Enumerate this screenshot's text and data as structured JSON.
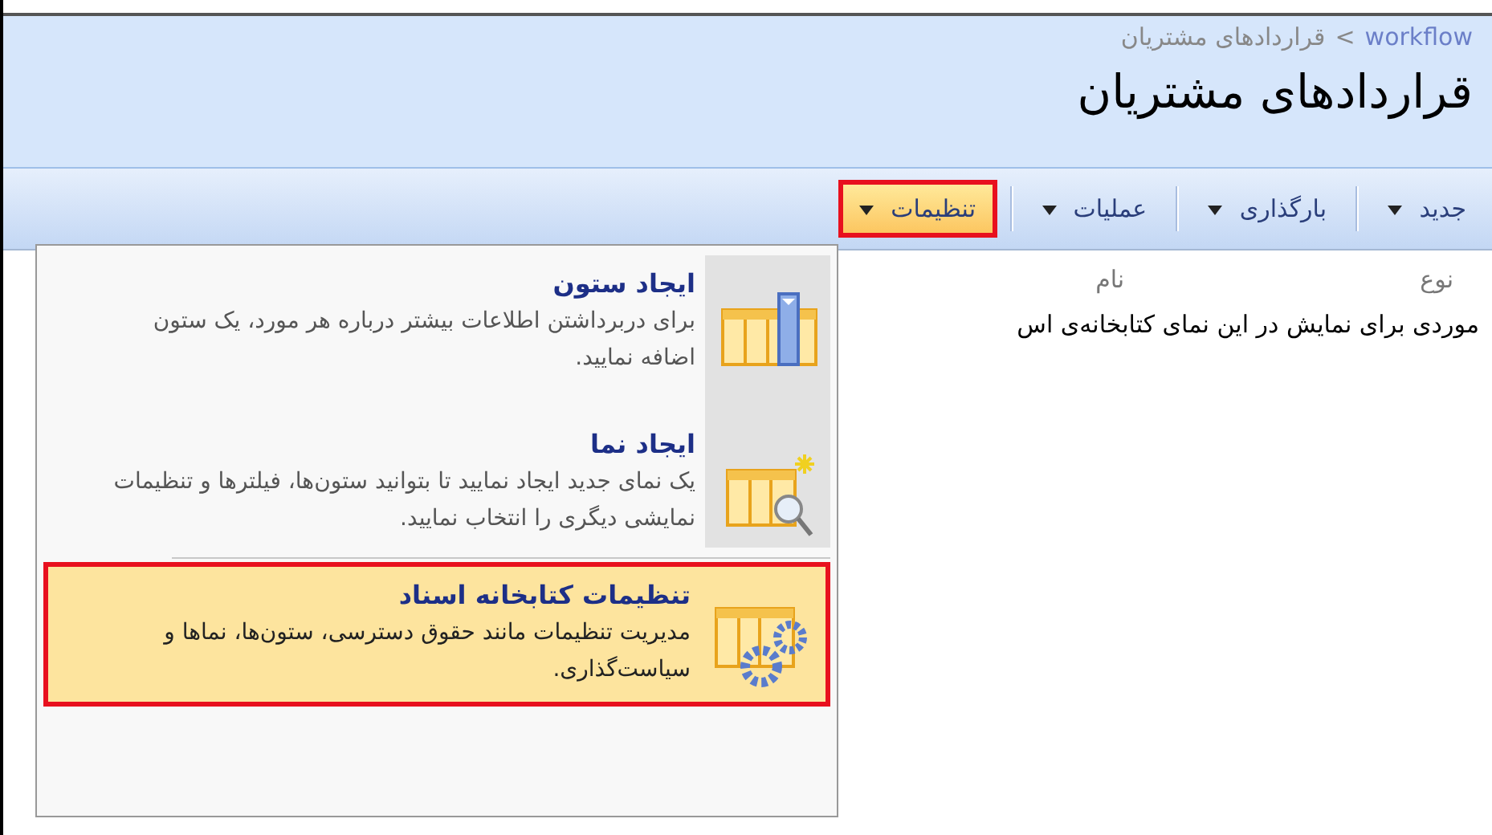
{
  "breadcrumb": {
    "root": "workflow",
    "separator": ">",
    "current": "قراردادهای مشتریان"
  },
  "page_title": "قراردادهای مشتریان",
  "toolbar": [
    {
      "label": "جدید",
      "selected": false
    },
    {
      "label": "بارگذاری",
      "selected": false
    },
    {
      "label": "عملیات",
      "selected": false
    },
    {
      "label": "تنظیمات",
      "selected": true
    }
  ],
  "table": {
    "columns": [
      "نوع",
      "نام"
    ],
    "empty_message": "موردی برای نمایش در این نمای کتابخانه‌ی اس"
  },
  "menu": [
    {
      "kind": "column",
      "title": "ایجاد ستون",
      "description": "برای دربرداشتن اطلاعات بیشتر درباره هر مورد، یک ستون اضافه نمایید.",
      "selected": false
    },
    {
      "kind": "view",
      "title": "ایجاد نما",
      "description": "یک نمای جدید ایجاد نمایید تا بتوانید ستون‌ها، فیلترها و تنظیمات نمایشی دیگری را انتخاب نمایید.",
      "selected": false
    },
    {
      "kind": "settings",
      "title": "تنظیمات کتابخانه اسناد",
      "description": "مدیریت تنظیمات مانند حقوق دسترسی، ستون‌ها، نماها و سیاست‌گذاری.",
      "selected": true
    }
  ]
}
